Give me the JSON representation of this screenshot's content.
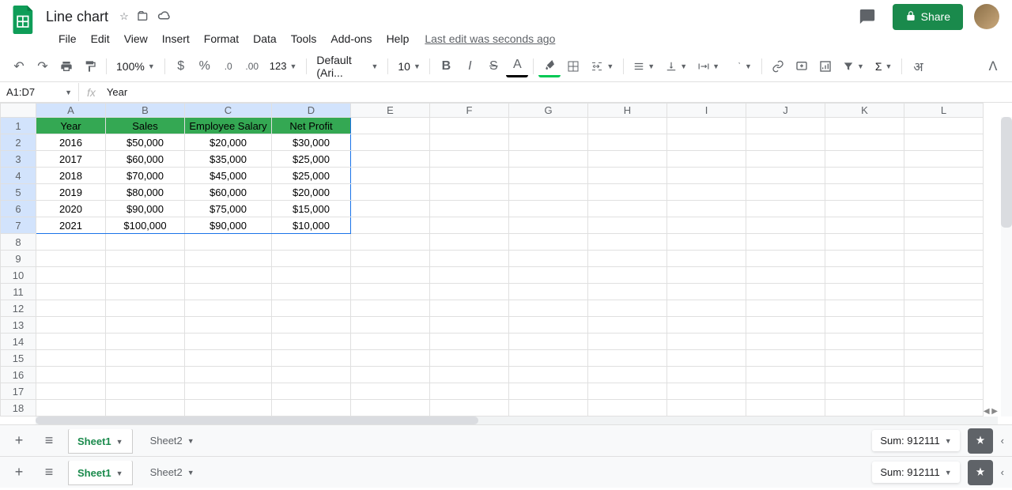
{
  "doc": {
    "title": "Line chart",
    "last_edit": "Last edit was seconds ago"
  },
  "menu": [
    "File",
    "Edit",
    "View",
    "Insert",
    "Format",
    "Data",
    "Tools",
    "Add-ons",
    "Help"
  ],
  "toolbar": {
    "zoom": "100%",
    "font": "Default (Ari...",
    "font_size": "10",
    "more_formats": "123"
  },
  "namebox": "A1:D7",
  "formula_value": "Year",
  "columns": [
    "A",
    "B",
    "C",
    "D",
    "E",
    "F",
    "G",
    "H",
    "I",
    "J",
    "K",
    "L"
  ],
  "rows": [
    1,
    2,
    3,
    4,
    5,
    6,
    7,
    8,
    9,
    10,
    11,
    12,
    13,
    14,
    15,
    16,
    17,
    18
  ],
  "share_label": "Share",
  "table": {
    "headers": [
      "Year",
      "Sales",
      "Employee Salary",
      "Net Profit"
    ],
    "data": [
      [
        "2016",
        "$50,000",
        "$20,000",
        "$30,000"
      ],
      [
        "2017",
        "$60,000",
        "$35,000",
        "$25,000"
      ],
      [
        "2018",
        "$70,000",
        "$45,000",
        "$25,000"
      ],
      [
        "2019",
        "$80,000",
        "$60,000",
        "$20,000"
      ],
      [
        "2020",
        "$90,000",
        "$75,000",
        "$15,000"
      ],
      [
        "2021",
        "$100,000",
        "$90,000",
        "$10,000"
      ]
    ]
  },
  "sheets": [
    {
      "name": "Sheet1",
      "active": true
    },
    {
      "name": "Sheet2",
      "active": false
    }
  ],
  "status": {
    "sum_label": "Sum: 912111"
  },
  "chart_data": {
    "type": "table",
    "categories": [
      2016,
      2017,
      2018,
      2019,
      2020,
      2021
    ],
    "series": [
      {
        "name": "Sales",
        "values": [
          50000,
          60000,
          70000,
          80000,
          90000,
          100000
        ]
      },
      {
        "name": "Employee Salary",
        "values": [
          20000,
          35000,
          45000,
          60000,
          75000,
          90000
        ]
      },
      {
        "name": "Net Profit",
        "values": [
          30000,
          25000,
          25000,
          20000,
          15000,
          10000
        ]
      }
    ],
    "title": "Line chart",
    "xlabel": "Year",
    "ylabel": ""
  }
}
